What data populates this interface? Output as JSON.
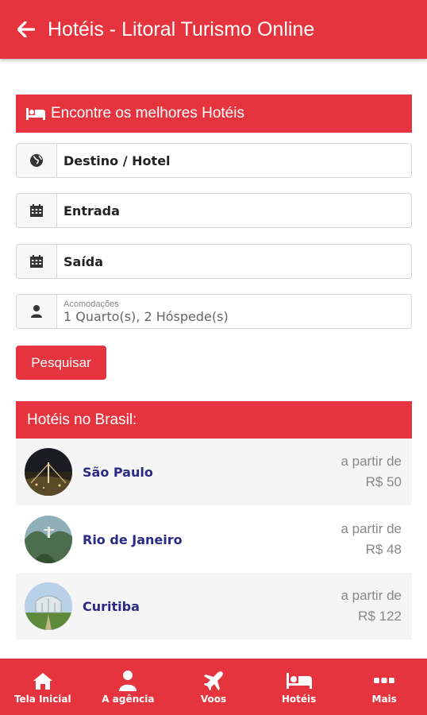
{
  "appbar": {
    "title": "Hotéis - Litoral Turismo Online",
    "back_icon": "arrow-left-icon"
  },
  "search": {
    "header": "Encontre os melhores Hotéis",
    "destination": "Destino / Hotel",
    "checkin": "Entrada",
    "checkout": "Saída",
    "rooms_label": "Acomodações",
    "rooms_value": "1 Quarto(s), 2 Hóspede(s)",
    "button": "Pesquisar"
  },
  "list": {
    "header": "Hotéis no Brasil:",
    "items": [
      {
        "name": "São Paulo",
        "price_label": "a partir de",
        "price": "R$ 50"
      },
      {
        "name": "Rio de Janeiro",
        "price_label": "a partir de",
        "price": "R$ 48"
      },
      {
        "name": "Curitiba",
        "price_label": "a partir de",
        "price": "R$ 122"
      }
    ]
  },
  "nav": [
    {
      "label": "Tela Inicial",
      "icon": "home-icon"
    },
    {
      "label": "A agência",
      "icon": "person-icon"
    },
    {
      "label": "Voos",
      "icon": "airplane-icon"
    },
    {
      "label": "Hotéis",
      "icon": "bed-icon"
    },
    {
      "label": "Mais",
      "icon": "more-icon"
    }
  ],
  "colors": {
    "brand": "#e5343e",
    "city_text": "#2a2a86"
  }
}
